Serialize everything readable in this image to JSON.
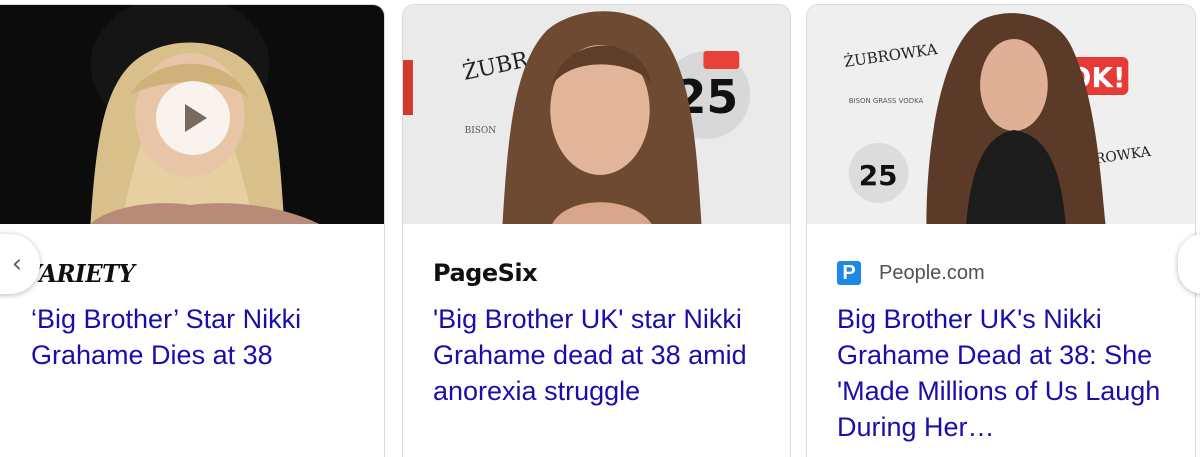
{
  "cards": [
    {
      "source": "VARIETY",
      "source_type": "logo",
      "title": "‘Big Brother’ Star Nikki Grahame Dies at 38",
      "has_video": true,
      "icon": "play-icon"
    },
    {
      "source": "PageSix",
      "source_type": "logo",
      "title": "'Big Brother UK' star Nikki Grahame dead at 38 amid anorexia struggle",
      "has_video": false
    },
    {
      "source": "People.com",
      "source_type": "favicon+text",
      "favicon_letter": "P",
      "favicon_color": "#1e88e5",
      "title": "Big Brother UK's Nikki Grahame Dead at 38: She 'Made Millions of Us Laugh During Her…",
      "has_video": false
    }
  ],
  "nav": {
    "prev_icon": "chevron-left-icon",
    "prev_glyph": "‹",
    "next_icon": "chevron-right-icon"
  },
  "colors": {
    "title_link": "#1a0dab",
    "source_text": "#4d5156",
    "card_border": "#dadce0"
  }
}
